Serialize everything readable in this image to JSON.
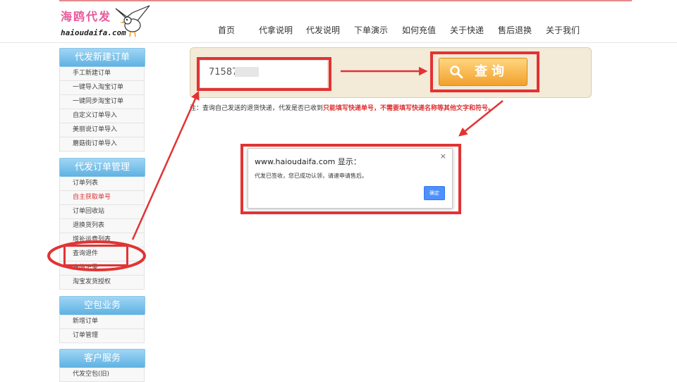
{
  "logo": {
    "chinese": "海鸥代发",
    "domain": "haioudaifa.com"
  },
  "nav": [
    "首页",
    "代拿说明",
    "代发说明",
    "下单演示",
    "如何充值",
    "关于快递",
    "售后退换",
    "关于我们"
  ],
  "sidebar": [
    {
      "title": "代发新建订单",
      "items": [
        "手工新建订单",
        "一键导入淘宝订单",
        "一键同步淘宝订单",
        "自定义订单导入",
        "美丽说订单导入",
        "蘑菇街订单导入"
      ]
    },
    {
      "title": "代发订单管理",
      "items": [
        "订单列表",
        "自主获取单号",
        "订单回收站",
        "退换货列表",
        "增补运费列表",
        "查询退件",
        "充值记录",
        "淘宝发货授权"
      ]
    },
    {
      "title": "空包业务",
      "items": [
        "新增订单",
        "订单管理"
      ]
    },
    {
      "title": "客户服务",
      "items": [
        "代发空包(旧)"
      ]
    }
  ],
  "query": {
    "value": "71587",
    "button_label": "查询"
  },
  "note": {
    "prefix": "注：查询自己发送的退货快递，代发是否已收到",
    "warning": "只能填写快递单号，不需要填写快递名称等其他文字和符号。"
  },
  "dialog": {
    "title": "www.haioudaifa.com 显示：",
    "close": "×",
    "message": "代发已签收，您已成功认领，请速申请售后。",
    "ok_label": "确定"
  },
  "colors": {
    "annotation": "#e23333",
    "menu_title": "#5fb2e2",
    "query_button": "#f2a12b",
    "warning_text": "#e03030"
  },
  "icons": {
    "query": "magnifier-icon",
    "close": "close-icon",
    "mascot": "seagull-icon"
  }
}
